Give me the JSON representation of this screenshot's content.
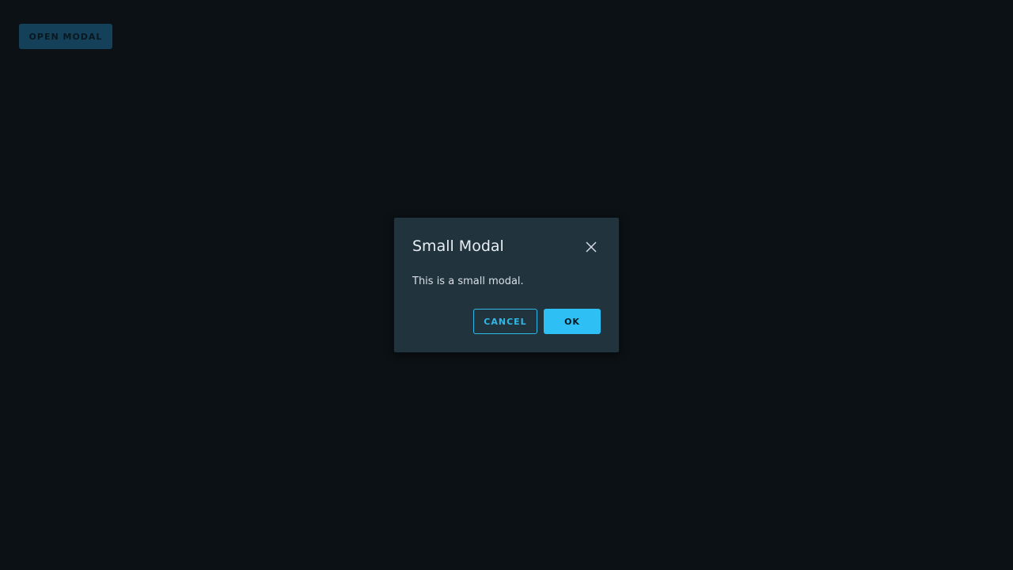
{
  "page": {
    "open_button_label": "OPEN MODAL"
  },
  "modal": {
    "title": "Small Modal",
    "body": "This is a small modal.",
    "close_icon": "close-icon",
    "cancel_label": "CANCEL",
    "ok_label": "OK"
  },
  "colors": {
    "background": "#0c1115",
    "modal_background": "#21333c",
    "accent": "#2ec0f5",
    "open_button_background": "#14405a"
  }
}
